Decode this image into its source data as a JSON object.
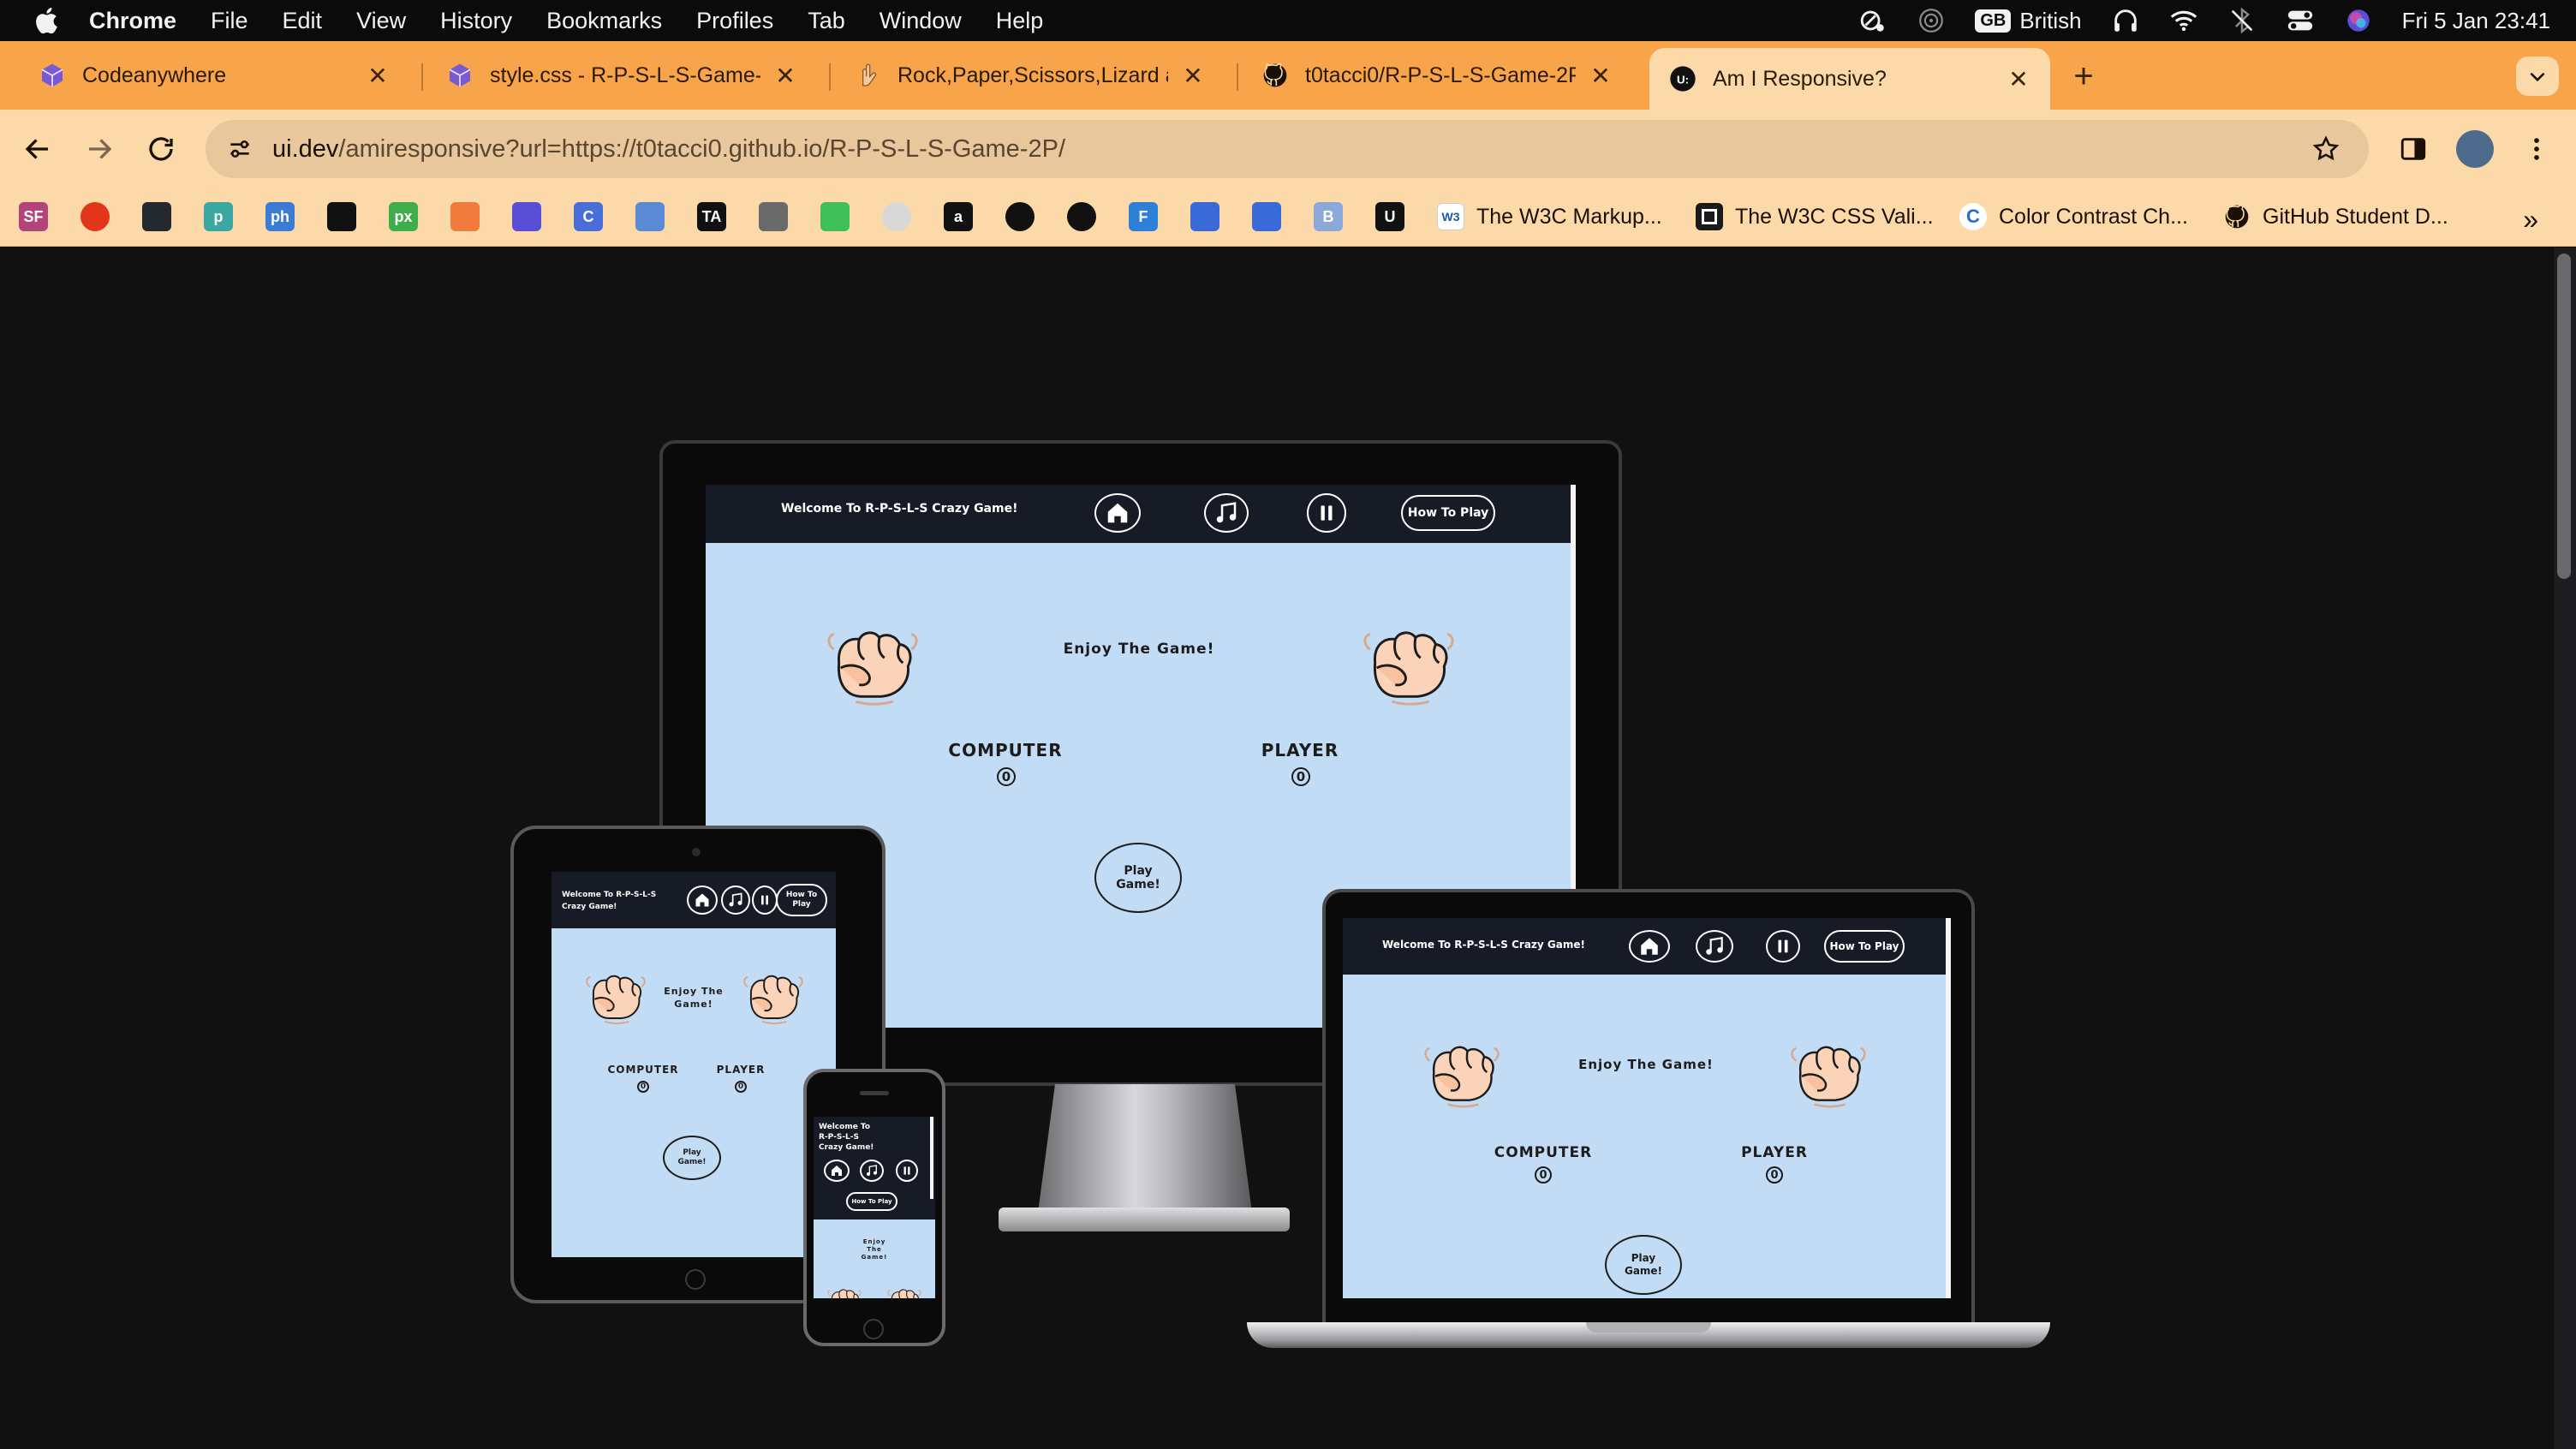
{
  "menubar": {
    "items": [
      "Chrome",
      "File",
      "Edit",
      "View",
      "History",
      "Bookmarks",
      "Profiles",
      "Tab",
      "Window",
      "Help"
    ],
    "input_badge": "GB",
    "input_source": "British",
    "datetime": "Fri 5 Jan  23:41"
  },
  "tabs": [
    {
      "title": "Codeanywhere",
      "icon": "cube-icon"
    },
    {
      "title": "style.css - R-P-S-L-S-Game-",
      "icon": "cube-icon"
    },
    {
      "title": "Rock,Paper,Scissors,Lizard ar",
      "icon": "hand-icon"
    },
    {
      "title": "t0tacci0/R-P-S-L-S-Game-2P",
      "icon": "github-icon"
    },
    {
      "title": "Am I Responsive?",
      "icon": "ui-dev-icon"
    }
  ],
  "active_tab": 4,
  "toolbar": {
    "url_host": "ui.dev",
    "url_rest": "/amiresponsive?url=https://t0tacci0.github.io/R-P-S-L-S-Game-2P/"
  },
  "bookmarks": {
    "icons": [
      {
        "name": "sf-icon",
        "label": "SF",
        "color": "#b3447a"
      },
      {
        "name": "circle-icon",
        "label": "",
        "color": "#e2361a"
      },
      {
        "name": "github-icon",
        "label": "",
        "color": "#24292f"
      },
      {
        "name": "p-icon",
        "label": "p",
        "color": "#3aa7a0"
      },
      {
        "name": "ph-icon",
        "label": "ph",
        "color": "#3b7bd4"
      },
      {
        "name": "unsplash-icon",
        "label": "",
        "color": "#111111"
      },
      {
        "name": "px-icon",
        "label": "px",
        "color": "#3fae4a"
      },
      {
        "name": "spark-icon",
        "label": "",
        "color": "#f07b3c"
      },
      {
        "name": "square-icon",
        "label": "",
        "color": "#5a4fd4"
      },
      {
        "name": "c-icon",
        "label": "C",
        "color": "#4a6ed8"
      },
      {
        "name": "dots-icon",
        "label": "",
        "color": "#5a8ad4"
      },
      {
        "name": "ta-icon",
        "label": "TA",
        "color": "#111111"
      },
      {
        "name": "grid-icon",
        "label": "",
        "color": "#6a6a6a"
      },
      {
        "name": "clover-icon",
        "label": "",
        "color": "#3fbf5a"
      },
      {
        "name": "ball-icon",
        "label": "",
        "color": "#d8d8d8"
      },
      {
        "name": "a-icon",
        "label": "a",
        "color": "#111111"
      },
      {
        "name": "globe-icon",
        "label": "",
        "color": "#111111"
      },
      {
        "name": "globe2-icon",
        "label": "",
        "color": "#111111"
      },
      {
        "name": "f-icon",
        "label": "F",
        "color": "#2e7fd8"
      },
      {
        "name": "puzzle-icon",
        "label": "",
        "color": "#3a6ad8"
      },
      {
        "name": "flag-icon",
        "label": "",
        "color": "#3a6ad8"
      },
      {
        "name": "b-icon",
        "label": "B",
        "color": "#8aa8d8"
      },
      {
        "name": "ui-icon",
        "label": "U",
        "color": "#111111"
      }
    ],
    "items": [
      {
        "label": "The W3C Markup...",
        "icon": "w3c-icon"
      },
      {
        "label": "The W3C CSS Vali...",
        "icon": "css-validator-icon"
      },
      {
        "label": "Color Contrast Ch...",
        "icon": "color-contrast-icon"
      },
      {
        "label": "GitHub Student D...",
        "icon": "github-icon"
      }
    ]
  },
  "game": {
    "title": "Welcome To R-P-S-L-S Crazy Game!",
    "title_line1": "Welcome To R-P-S-L-S",
    "title_line2": "Crazy Game!",
    "phone_line1": "Welcome To",
    "phone_line2": "R-P-S-L-S",
    "phone_line3": "Crazy Game!",
    "how_to_play": "How To Play",
    "how_line1": "How To",
    "how_line2": "Play",
    "enjoy": "Enjoy  The  Game!",
    "enjoy_line1": "Enjoy  The",
    "enjoy_line2": "Game!",
    "enjoy_p1": "Enjoy",
    "enjoy_p2": "The",
    "enjoy_p3": "Game!",
    "computer_label": "COMPUTER",
    "player_label": "PLAYER",
    "computer_score": "0",
    "player_score": "0",
    "play_line1": "Play",
    "play_line2": "Game!"
  },
  "colors": {
    "chrome_accent": "#f7a44a",
    "toolbar": "#fcd9a9",
    "game_header": "#161b26",
    "game_bg": "#c3dcf6"
  }
}
